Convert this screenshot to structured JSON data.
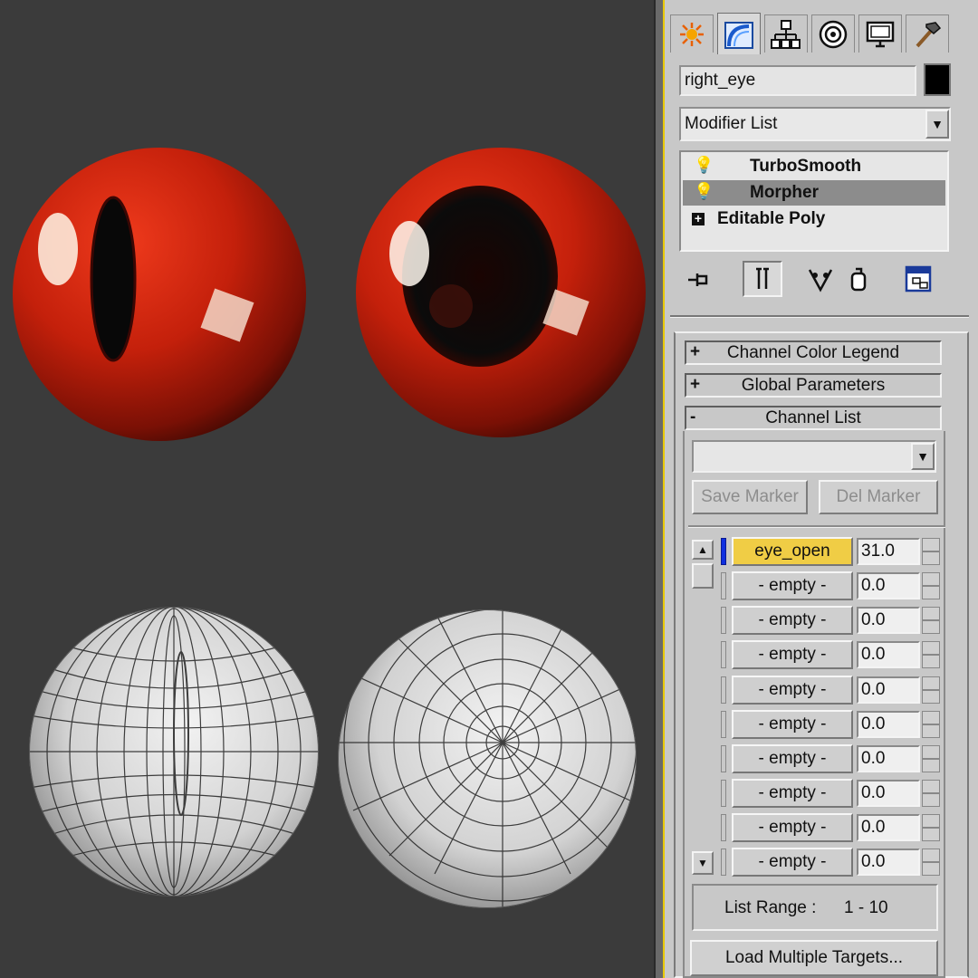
{
  "command_panel": {
    "tabs": [
      {
        "name": "create",
        "icon": "sun-burst-icon"
      },
      {
        "name": "modify",
        "icon": "modify-arc-icon"
      },
      {
        "name": "hierarchy",
        "icon": "hierarchy-icon"
      },
      {
        "name": "motion",
        "icon": "motion-circle-icon"
      },
      {
        "name": "display",
        "icon": "monitor-icon"
      },
      {
        "name": "utilities",
        "icon": "hammer-icon"
      }
    ],
    "active_tab": "modify",
    "object_name": "right_eye",
    "object_color": "#000000",
    "modifier_list_label": "Modifier List",
    "stack": [
      {
        "label": "TurboSmooth",
        "icon": "lightbulb-icon",
        "selected": false
      },
      {
        "label": "Morpher",
        "icon": "lightbulb-icon",
        "selected": true
      },
      {
        "label": "Editable Poly",
        "icon": "expand-plus-icon",
        "selected": false
      }
    ]
  },
  "rollouts": {
    "channel_color_legend": {
      "sign": "+",
      "label": "Channel Color Legend"
    },
    "global_parameters": {
      "sign": "+",
      "label": "Global Parameters"
    },
    "channel_list": {
      "sign": "-",
      "label": "Channel List"
    }
  },
  "channel_list": {
    "marker_value": "",
    "save_marker": "Save Marker",
    "del_marker": "Del Marker",
    "channels": [
      {
        "name": "eye_open",
        "value": "31.0",
        "active": true
      },
      {
        "name": "- empty -",
        "value": "0.0",
        "active": false
      },
      {
        "name": "- empty -",
        "value": "0.0",
        "active": false
      },
      {
        "name": "- empty -",
        "value": "0.0",
        "active": false
      },
      {
        "name": "- empty -",
        "value": "0.0",
        "active": false
      },
      {
        "name": "- empty -",
        "value": "0.0",
        "active": false
      },
      {
        "name": "- empty -",
        "value": "0.0",
        "active": false
      },
      {
        "name": "- empty -",
        "value": "0.0",
        "active": false
      },
      {
        "name": "- empty -",
        "value": "0.0",
        "active": false
      },
      {
        "name": "- empty -",
        "value": "0.0",
        "active": false
      }
    ],
    "list_range_label": "List Range :",
    "list_range_value": "1 - 10",
    "load_targets": "Load Multiple Targets..."
  },
  "colors": {
    "viewport_bg": "#3b3b3b",
    "eye_red": "#c9200c",
    "active_channel": "#f0cd45",
    "active_channel_bar": "#1030e0",
    "panel_border_accent": "#e8c800"
  }
}
